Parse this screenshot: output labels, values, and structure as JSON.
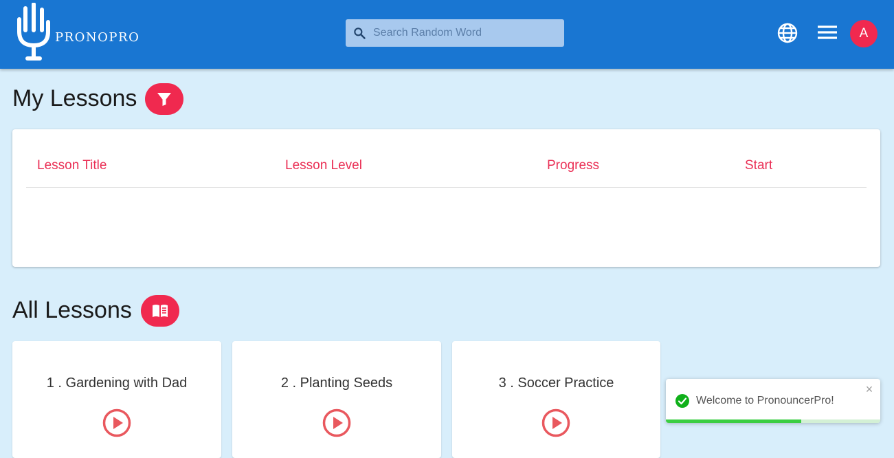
{
  "header": {
    "logo_text": "PRONOPRO",
    "search_placeholder": "Search Random Word",
    "avatar_initial": "A"
  },
  "my_lessons": {
    "title": "My Lessons",
    "columns": [
      "Lesson Title",
      "Lesson Level",
      "Progress",
      "Start"
    ]
  },
  "all_lessons": {
    "title": "All Lessons",
    "items": [
      {
        "label": "1 . Gardening with Dad"
      },
      {
        "label": "2 . Planting Seeds"
      },
      {
        "label": "3 . Soccer Practice"
      }
    ]
  },
  "toast": {
    "message": "Welcome to PronouncerPro!",
    "close_glyph": "×",
    "progress": 0.63
  },
  "icons": {
    "logo": "microphone-hand-logo",
    "search": "search-icon",
    "globe": "globe-icon",
    "menu": "hamburger-menu-icon",
    "filter": "filter-icon",
    "book": "open-book-icon",
    "play": "play-circle-icon",
    "success": "check-circle-icon"
  },
  "colors": {
    "appbar": "#1976d2",
    "background": "#d8eefb",
    "accent": "#f0294f",
    "table_header": "#ea2f55",
    "play": "#e9585e",
    "success": "#3bce42"
  }
}
